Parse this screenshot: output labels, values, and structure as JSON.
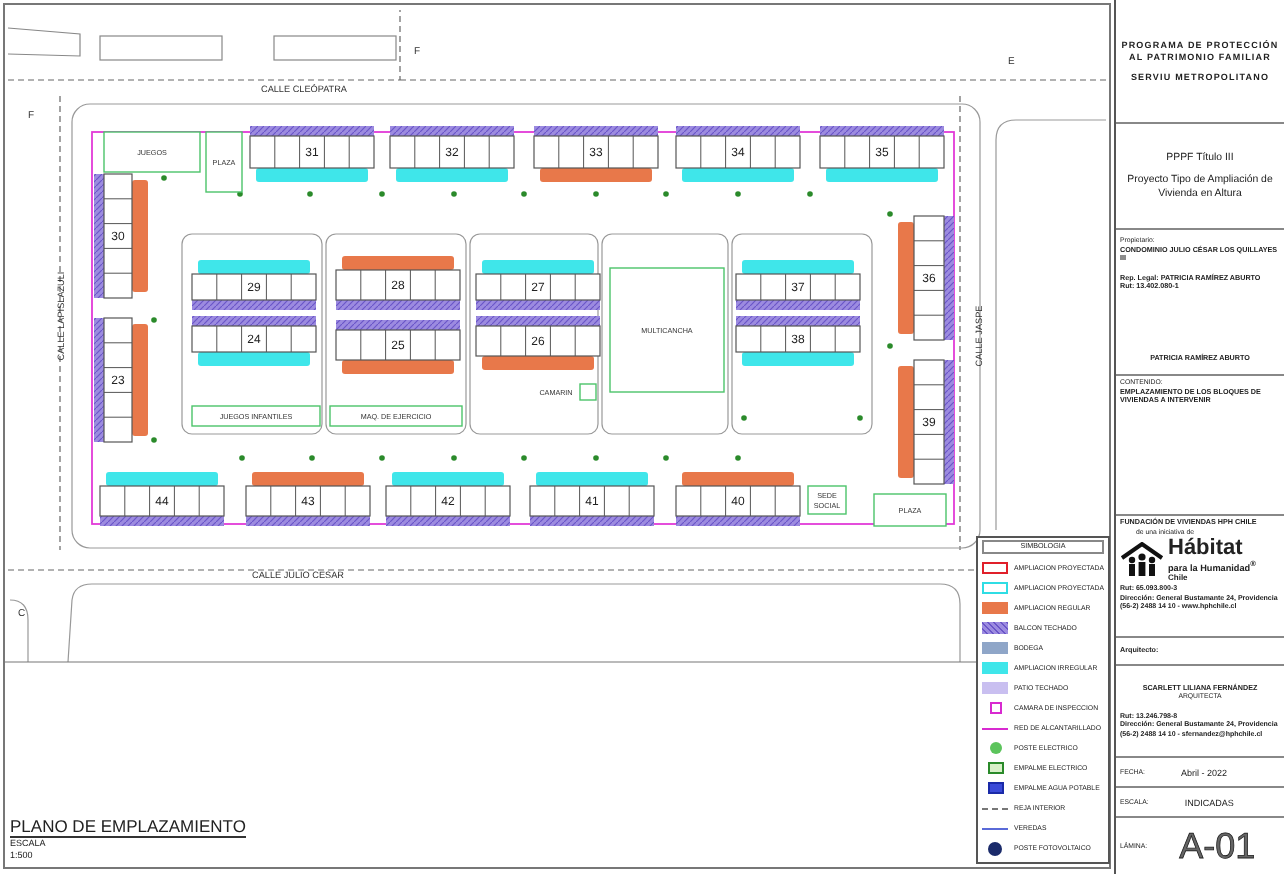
{
  "plan": {
    "streets": [
      {
        "name": "CALLE CLEÓPATRA"
      },
      {
        "name": "CALLE LAPISLAZULI"
      },
      {
        "name": "CALLE JASPE"
      },
      {
        "name": "CALLE JULIO CESAR"
      }
    ],
    "section_marks": [
      "F",
      "F",
      "E",
      "C"
    ],
    "blocks": [
      {
        "number": "31",
        "kind": "proyectada"
      },
      {
        "number": "32",
        "kind": "proyectada"
      },
      {
        "number": "33",
        "kind": "regular"
      },
      {
        "number": "34",
        "kind": "proyectada"
      },
      {
        "number": "35",
        "kind": "proyectada"
      },
      {
        "number": "30",
        "kind": "regular"
      },
      {
        "number": "29",
        "kind": "proyectada"
      },
      {
        "number": "28",
        "kind": "regular"
      },
      {
        "number": "27",
        "kind": "proyectada"
      },
      {
        "number": "37",
        "kind": "proyectada"
      },
      {
        "number": "36",
        "kind": "regular"
      },
      {
        "number": "24",
        "kind": "proyectada"
      },
      {
        "number": "25",
        "kind": "regular"
      },
      {
        "number": "26",
        "kind": "regular"
      },
      {
        "number": "38",
        "kind": "proyectada"
      },
      {
        "number": "23",
        "kind": "regular"
      },
      {
        "number": "39",
        "kind": "regular"
      },
      {
        "number": "44",
        "kind": "proyectada"
      },
      {
        "number": "43",
        "kind": "regular"
      },
      {
        "number": "42",
        "kind": "proyectada"
      },
      {
        "number": "41",
        "kind": "proyectada"
      },
      {
        "number": "40",
        "kind": "regular"
      }
    ],
    "areas": [
      {
        "label": "JUEGOS"
      },
      {
        "label": "PLAZA"
      },
      {
        "label": "JUEGOS INFANTILES"
      },
      {
        "label": "MAQ. DE EJERCICIO"
      },
      {
        "label": "MULTICANCHA"
      },
      {
        "label": "CAMARIN"
      },
      {
        "label": "SEDE SOCIAL"
      },
      {
        "label": "PLAZA"
      }
    ],
    "title": "PLANO DE EMPLAZAMIENTO",
    "scale_label": "ESCALA",
    "scale": "1:500"
  },
  "legend": {
    "title": "SIMBOLOGIA",
    "items": [
      {
        "label": "AMPLIACION PROYECTADA",
        "kind": "outline-red"
      },
      {
        "label": "AMPLIACION PROYECTADA",
        "kind": "outline-cyan"
      },
      {
        "label": "AMPLIACION REGULAR",
        "kind": "fill-orange"
      },
      {
        "label": "BALCON TECHADO",
        "kind": "hatch"
      },
      {
        "label": "BODEGA",
        "kind": "fill-slate"
      },
      {
        "label": "AMPLIACION IRREGULAR",
        "kind": "fill-cyan"
      },
      {
        "label": "PATIO TECHADO",
        "kind": "fill-lavender"
      },
      {
        "label": "CAMARA DE INSPECCION",
        "kind": "manhole"
      },
      {
        "label": "RED DE ALCANTARILLADO",
        "kind": "line-magenta"
      },
      {
        "label": "POSTE ELECTRICO",
        "kind": "pole"
      },
      {
        "label": "EMPALME ELECTRICO",
        "kind": "box-green"
      },
      {
        "label": "EMPALME AGUA POTABLE",
        "kind": "box-blue"
      },
      {
        "label": "REJA INTERIOR",
        "kind": "line-dashed"
      },
      {
        "label": "VEREDAS",
        "kind": "line-blue"
      },
      {
        "label": "POSTE FOTOVOLTAICO",
        "kind": "solar"
      }
    ]
  },
  "title_block": {
    "program": "PROGRAMA DE PROTECCIÓN AL PATRIMONIO FAMILIAR",
    "agency": "SERVIU METROPOLITANO",
    "project_line": "PPPF  Título III",
    "project_title": "Proyecto Tipo de Ampliación de Vivienda en Altura",
    "owner_label": "Propietario:",
    "owner": "CONDOMINIO JULIO CÉSAR LOS QUILLAYES III",
    "legal_rep": "Rep. Legal: PATRICIA RAMÍREZ ABURTO",
    "legal_rep_rut": "Rut: 13.402.080-1",
    "signature_name": "PATRICIA RAMÍREZ ABURTO",
    "content_label": "CONTENIDO:",
    "content": "EMPLAZAMIENTO DE LOS BLOQUES DE VIVIENDAS A INTERVENIR",
    "foundation": "FUNDACIÓN DE VIVIENDAS HPH CHILE",
    "foundation_sub": "de una iniciativa de",
    "logo_name": "Hábitat",
    "logo_sub": "para la Humanidad$^{®}$",
    "logo_country": "Chile",
    "foundation_rut": "Rut: 65.093.800-3",
    "foundation_address": "Dirección: General Bustamante 24, Providencia",
    "foundation_contact": "(56-2) 2488 14 10 - www.hphchile.cl",
    "architect_label": "Arquitecto:",
    "architect": "SCARLETT LILIANA FERNÁNDEZ",
    "architect_title": "ARQUITECTA",
    "architect_rut": "Rut: 13.246.798-8",
    "architect_address": "Dirección: General Bustamante 24, Providencia",
    "architect_contact": "(56-2) 2488 14 10 - sfernandez@hphchile.cl",
    "date_label": "FECHA:",
    "date": "Abril - 2022",
    "scale_label": "ESCALA:",
    "scale": "INDICADAS",
    "sheet_label": "LÁMINA:",
    "sheet": "A-01"
  }
}
